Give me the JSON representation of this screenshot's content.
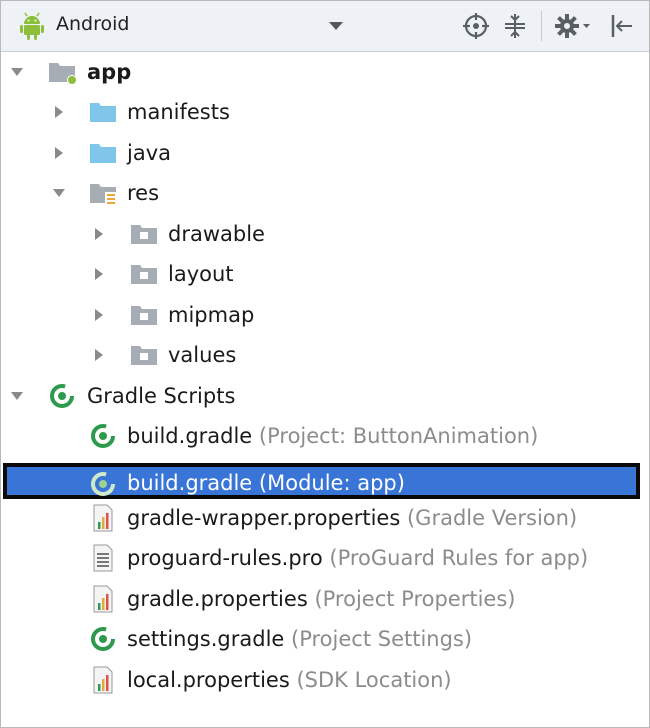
{
  "toolbar": {
    "view_label": "Android",
    "icons": [
      "android-icon",
      "dropdown-caret-icon",
      "locate-target-icon",
      "collapse-all-icon",
      "gear-icon",
      "hide-panel-icon"
    ]
  },
  "tree": {
    "items": [
      {
        "label": "app",
        "sub": "",
        "icon": "module-folder-icon",
        "expanded": true
      },
      {
        "label": "manifests",
        "sub": "",
        "icon": "folder-icon",
        "expanded": false
      },
      {
        "label": "java",
        "sub": "",
        "icon": "folder-icon",
        "expanded": false
      },
      {
        "label": "res",
        "sub": "",
        "icon": "resources-folder-icon",
        "expanded": true
      },
      {
        "label": "drawable",
        "sub": "",
        "icon": "gray-folder-icon",
        "expanded": false
      },
      {
        "label": "layout",
        "sub": "",
        "icon": "gray-folder-icon",
        "expanded": false
      },
      {
        "label": "mipmap",
        "sub": "",
        "icon": "gray-folder-icon",
        "expanded": false
      },
      {
        "label": "values",
        "sub": "",
        "icon": "gray-folder-icon",
        "expanded": false
      },
      {
        "label": "Gradle Scripts",
        "sub": "",
        "icon": "gradle-icon",
        "expanded": true
      },
      {
        "label": "build.gradle",
        "sub": " (Project: ButtonAnimation)",
        "icon": "gradle-icon"
      },
      {
        "label": "build.gradle",
        "sub": " (Module: app)",
        "icon": "gradle-icon",
        "selected": true
      },
      {
        "label": "gradle-wrapper.properties",
        "sub": " (Gradle Version)",
        "icon": "properties-file-icon"
      },
      {
        "label": "proguard-rules.pro",
        "sub": " (ProGuard Rules for app)",
        "icon": "text-file-icon"
      },
      {
        "label": "gradle.properties",
        "sub": " (Project Properties)",
        "icon": "properties-file-icon"
      },
      {
        "label": "settings.gradle",
        "sub": " (Project Settings)",
        "icon": "gradle-icon"
      },
      {
        "label": "local.properties",
        "sub": " (SDK Location)",
        "icon": "properties-file-icon"
      }
    ]
  },
  "colors": {
    "selection": "#3875d7",
    "folder_blue": "#7fc6ea",
    "folder_gray": "#a7adb4",
    "gradle_green": "#2e9a4e",
    "android_green": "#8bbf3c",
    "secondary_text": "#8c8c8c"
  }
}
